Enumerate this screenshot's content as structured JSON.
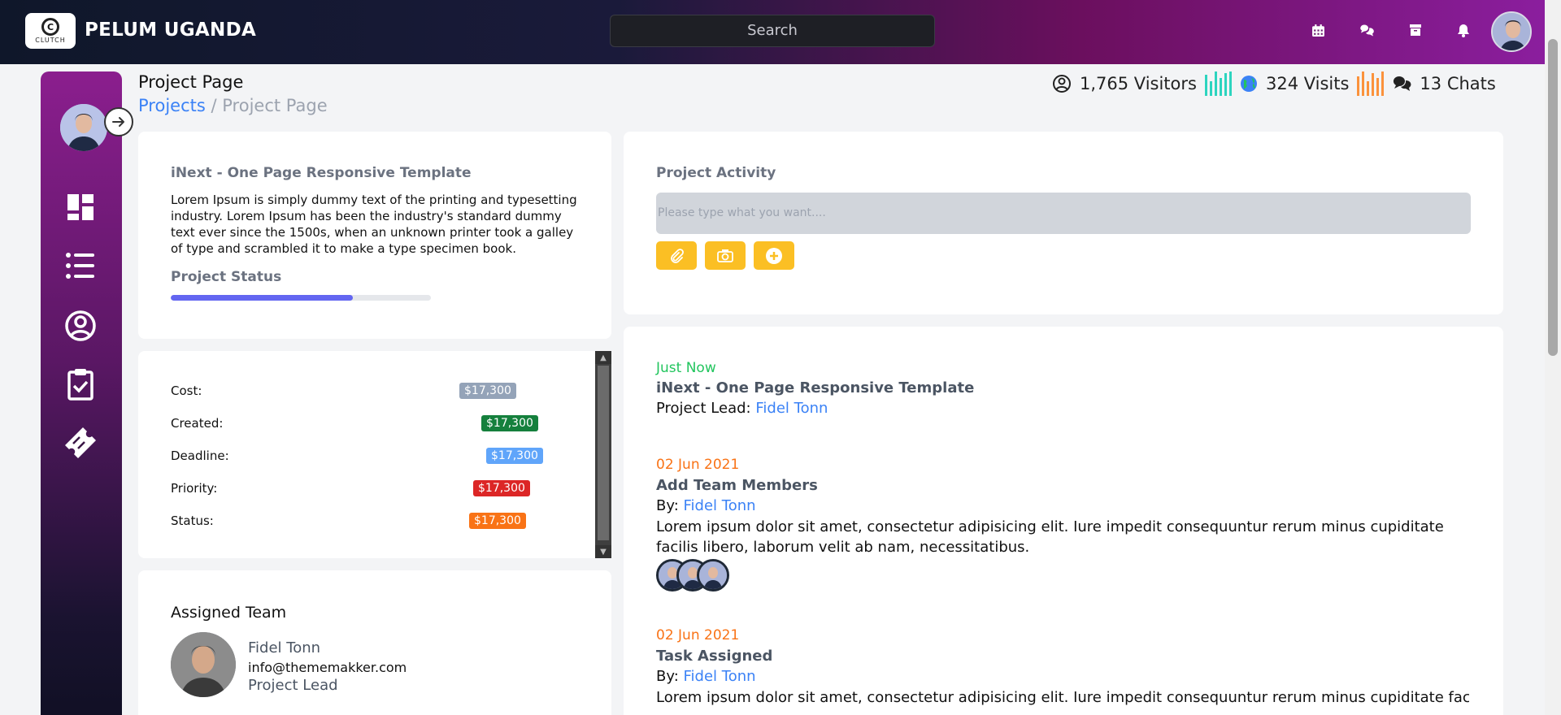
{
  "brand": {
    "name": "PELUM UGANDA",
    "logo_text": "CLUTCH",
    "logo_letter": "C"
  },
  "search": {
    "placeholder": "Search"
  },
  "page": {
    "title": "Project Page",
    "breadcrumb_link": "Projects",
    "breadcrumb_sep": "/",
    "breadcrumb_current": "Project Page"
  },
  "stats": {
    "visitors": "1,765 Visitors",
    "visits": "324 Visits",
    "chats": "13 Chats"
  },
  "project": {
    "title": "iNext - One Page Responsive Template",
    "description": "Lorem Ipsum is simply dummy text of the printing and typesetting industry. Lorem Ipsum has been the industry's standard dummy text ever since the 1500s, when an unknown printer took a galley of type and scrambled it to make a type specimen book.",
    "status_label": "Project Status",
    "status_progress": 0.7
  },
  "meta": [
    {
      "label": "Cost:",
      "value": "$17,300",
      "color": "#94a3b8"
    },
    {
      "label": "Created:",
      "value": "$17,300",
      "color": "#15803d"
    },
    {
      "label": "Deadline:",
      "value": "$17,300",
      "color": "#60a5fa"
    },
    {
      "label": "Priority:",
      "value": "$17,300",
      "color": "#dc2626"
    },
    {
      "label": "Status:",
      "value": "$17,300",
      "color": "#f97316"
    }
  ],
  "team": {
    "heading": "Assigned Team",
    "name": "Fidel Tonn",
    "email": "info@thememakker.com",
    "role": "Project Lead"
  },
  "activity": {
    "title": "Project Activity",
    "placeholder": "Please type what you want...."
  },
  "timeline": [
    {
      "date": "Just Now",
      "date_color": "#22c55e",
      "title": "iNext - One Page Responsive Template",
      "prefix": "Project Lead:",
      "person": "Fidel Tonn"
    },
    {
      "date": "02 Jun 2021",
      "date_color": "#f97316",
      "title": "Add Team Members",
      "prefix": "By:",
      "person": "Fidel Tonn",
      "text": "Lorem ipsum dolor sit amet, consectetur adipisicing elit. Iure impedit consequuntur rerum minus cupiditate facilis libero, laborum velit ab nam, necessitatibus."
    },
    {
      "date": "02 Jun 2021",
      "date_color": "#f97316",
      "title": "Task Assigned",
      "prefix": "By:",
      "person": "Fidel Tonn",
      "text": "Lorem ipsum dolor sit amet, consectetur adipisicing elit. Iure impedit consequuntur rerum minus cupiditate facilis"
    }
  ],
  "colors": {
    "accent": "#3b82f6",
    "button_yellow": "#fbbf24",
    "progress": "#6366f1"
  }
}
